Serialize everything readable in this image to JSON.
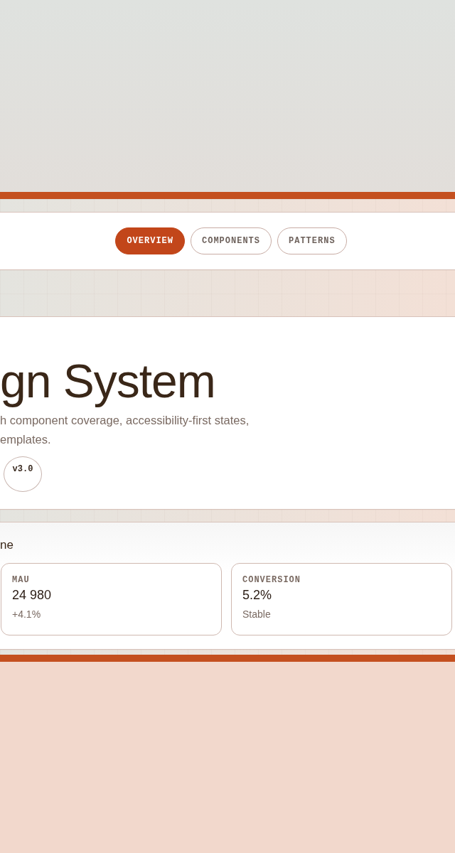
{
  "nav": {
    "tabs": [
      {
        "label": "OVERVIEW",
        "selected": true
      },
      {
        "label": "COMPONENTS",
        "selected": false
      },
      {
        "label": "PATTERNS",
        "selected": false
      }
    ]
  },
  "hero": {
    "title": "gn System",
    "description_lines": [
      "h component coverage, accessibility-first states,",
      "emplates."
    ],
    "badge": "v3.0"
  },
  "metrics": {
    "heading": "ne",
    "cards": [
      {
        "label": "MAU",
        "value": "24 980",
        "note": "+4.1%"
      },
      {
        "label": "CONVERSION",
        "value": "5.2%",
        "note": "Stable"
      }
    ]
  }
}
